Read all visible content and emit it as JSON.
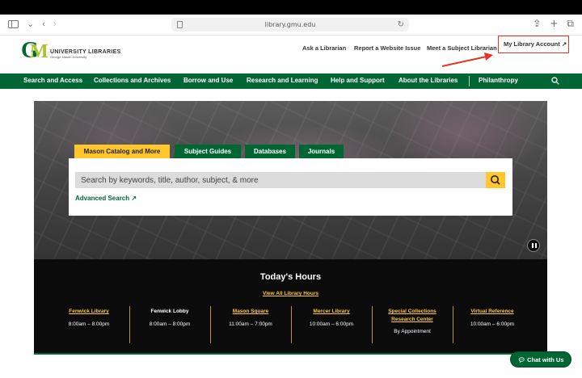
{
  "browser": {
    "url": "library.gmu.edu"
  },
  "header": {
    "logo_text": "UNIVERSITY LIBRARIES",
    "logo_subtext": "George Mason University",
    "utility_links": {
      "ask": "Ask a Librarian",
      "report": "Report a Website Issue",
      "meet": "Meet a Subject Librarian",
      "account": "My Library Account ↗"
    }
  },
  "nav": {
    "items": [
      "Search and Access",
      "Collections and Archives",
      "Borrow and Use",
      "Research and Learning",
      "Help and Support",
      "About the Libraries",
      "Philanthropy"
    ]
  },
  "search": {
    "tabs": [
      "Mason Catalog and More",
      "Subject Guides",
      "Databases",
      "Journals"
    ],
    "active_tab": "Mason Catalog and More",
    "placeholder": "Search by keywords, title, author, subject, & more",
    "advanced": "Advanced Search ↗"
  },
  "hours": {
    "title": "Today's Hours",
    "view_all": "View All Library Hours",
    "locations": [
      {
        "name": "Fenwick Library",
        "time": "8:00am – 8:00pm",
        "link": true
      },
      {
        "name": "Fenwick Lobby",
        "time": "8:00am – 8:00pm",
        "link": false
      },
      {
        "name": "Mason Square",
        "time": "11:00am – 7:00pm",
        "link": true
      },
      {
        "name": "Mercer Library",
        "time": "10:00am – 6:00pm",
        "link": true
      },
      {
        "name_line1": "Special Collections",
        "name_line2": "Research Center",
        "time": "By Appointment",
        "link": true
      },
      {
        "name": "Virtual Reference",
        "time": "10:00am – 6:00pm",
        "link": true
      }
    ]
  },
  "chat": {
    "label": "Chat with Us"
  },
  "colors": {
    "brand_green": "#006633",
    "brand_gold": "#ffc72c",
    "annotation_red": "#e53424"
  }
}
